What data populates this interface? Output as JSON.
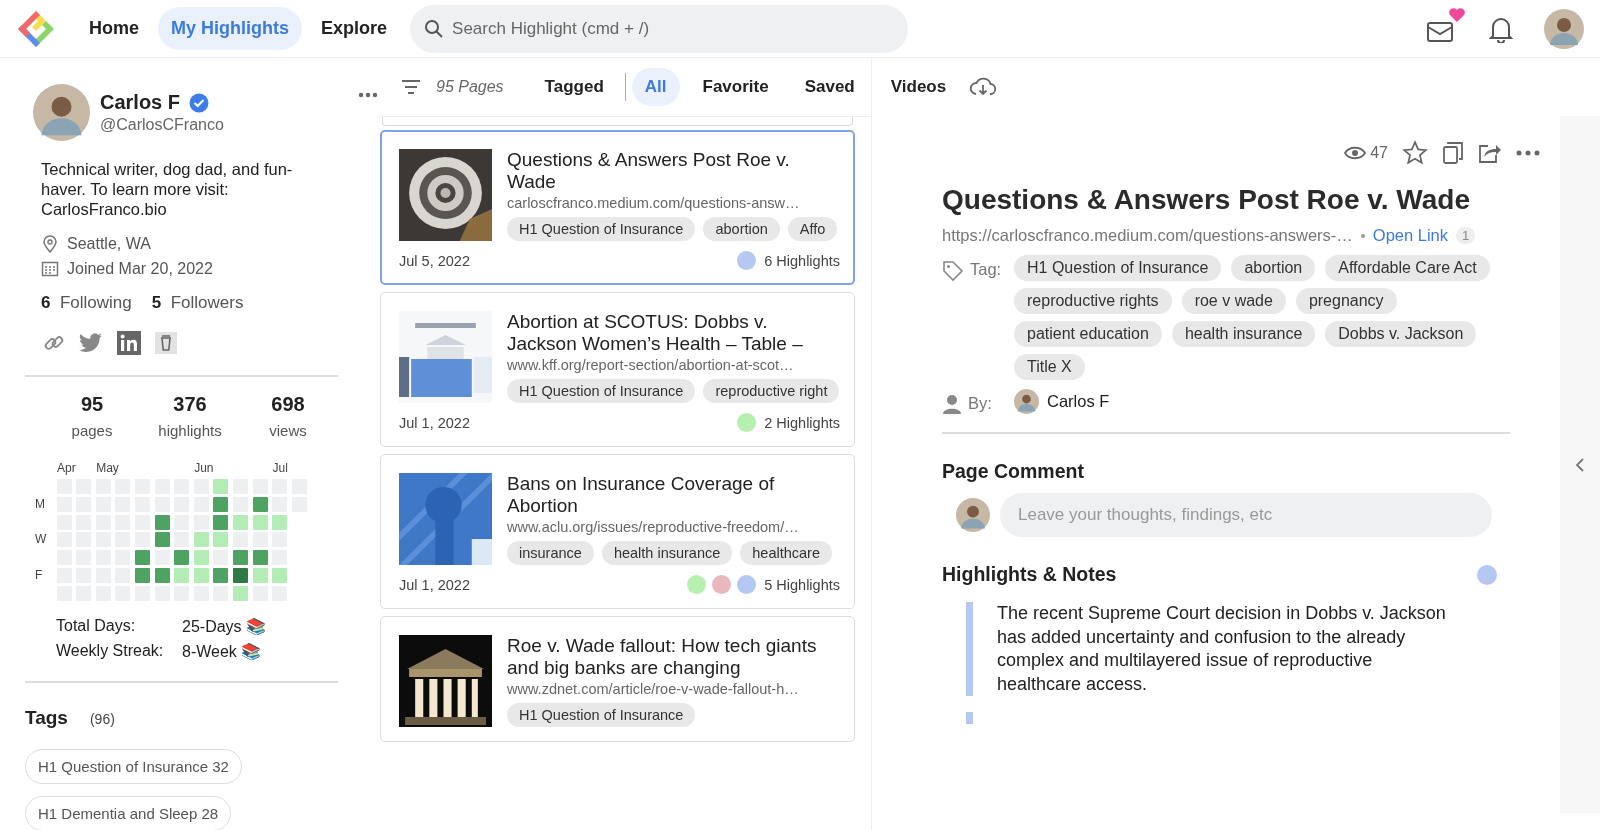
{
  "nav": {
    "items": [
      {
        "label": "Home",
        "selected": false
      },
      {
        "label": "My Highlights",
        "selected": true
      },
      {
        "label": "Explore",
        "selected": false
      }
    ],
    "search": {
      "placeholder": "Search Highlight (cmd + /)"
    },
    "mail_has_new": true
  },
  "profile": {
    "name": "Carlos F",
    "verified": true,
    "handle": "@CarlosCFranco",
    "bio": "Technical writer, dog dad, and fun-haver. To learn more visit: CarlosFranco.bio",
    "location": "Seattle, WA",
    "joined": "Joined Mar 20, 2022",
    "following_count": "6",
    "following_label": "Following",
    "followers_count": "5",
    "followers_label": "Followers"
  },
  "stats": [
    {
      "value": "95",
      "label": "pages"
    },
    {
      "value": "376",
      "label": "highlights"
    },
    {
      "value": "698",
      "label": "views"
    }
  ],
  "activity": {
    "months": [
      "Apr",
      "May",
      "Jun",
      "Jul"
    ],
    "rows": [
      {
        "cells": [
          {
            "color": "#eeeff1"
          },
          {
            "color": "#eeeff1"
          },
          {
            "color": "#eeeff1"
          },
          {
            "color": "#eeeff1"
          },
          {
            "color": "#eeeff1"
          },
          {
            "color": "#eeeff1"
          },
          {
            "color": "#eeeff1"
          },
          {
            "color": "#eeeff1"
          },
          {
            "color": "#b4ecb6"
          },
          {
            "color": "#eeeff1"
          },
          {
            "color": "#eeeff1"
          },
          {
            "color": "#eeeff1"
          },
          {
            "color": "#eeeff1"
          }
        ]
      },
      {
        "day": "M",
        "cells": [
          {
            "color": "#eeeff1"
          },
          {
            "color": "#eeeff1"
          },
          {
            "color": "#eeeff1"
          },
          {
            "color": "#eeeff1"
          },
          {
            "color": "#eeeff1"
          },
          {
            "color": "#eeeff1"
          },
          {
            "color": "#eeeff1"
          },
          {
            "color": "#eeeff1"
          },
          {
            "color": "#4fa362"
          },
          {
            "color": "#eeeff1"
          },
          {
            "color": "#4fa362"
          },
          {
            "color": "#eeeff1"
          },
          {
            "color": "#eeeff1"
          }
        ]
      },
      {
        "cells": [
          {
            "color": "#eeeff1"
          },
          {
            "color": "#eeeff1"
          },
          {
            "color": "#eeeff1"
          },
          {
            "color": "#eeeff1"
          },
          {
            "color": "#eeeff1"
          },
          {
            "color": "#4fa362"
          },
          {
            "color": "#eeeff1"
          },
          {
            "color": "#eeeff1"
          },
          {
            "color": "#4fa362"
          },
          {
            "color": "#b4ecb6"
          },
          {
            "color": "#b4ecb6"
          },
          {
            "color": "#b4ecb6"
          }
        ]
      },
      {
        "day": "W",
        "cells": [
          {
            "color": "#eeeff1"
          },
          {
            "color": "#eeeff1"
          },
          {
            "color": "#eeeff1"
          },
          {
            "color": "#eeeff1"
          },
          {
            "color": "#eeeff1"
          },
          {
            "color": "#4fa362"
          },
          {
            "color": "#eeeff1"
          },
          {
            "color": "#b4ecb6"
          },
          {
            "color": "#b4ecb6"
          },
          {
            "color": "#eeeff1"
          },
          {
            "color": "#eeeff1"
          },
          {
            "color": "#eeeff1"
          }
        ]
      },
      {
        "cells": [
          {
            "color": "#eeeff1"
          },
          {
            "color": "#eeeff1"
          },
          {
            "color": "#eeeff1"
          },
          {
            "color": "#eeeff1"
          },
          {
            "color": "#4fa362"
          },
          {
            "color": "#eeeff1"
          },
          {
            "color": "#4fa362"
          },
          {
            "color": "#b4ecb6"
          },
          {
            "color": "#eeeff1"
          },
          {
            "color": "#4fa362"
          },
          {
            "color": "#4fa362"
          },
          {
            "color": "#eeeff1"
          }
        ]
      },
      {
        "day": "F",
        "cells": [
          {
            "color": "#eeeff1"
          },
          {
            "color": "#eeeff1"
          },
          {
            "color": "#eeeff1"
          },
          {
            "color": "#eeeff1"
          },
          {
            "color": "#4fa362"
          },
          {
            "color": "#4fa362"
          },
          {
            "color": "#b4ecb6"
          },
          {
            "color": "#b4ecb6"
          },
          {
            "color": "#4fa362"
          },
          {
            "color": "#2f7a45"
          },
          {
            "color": "#b4ecb6"
          },
          {
            "color": "#b4ecb6"
          }
        ]
      },
      {
        "cells": [
          {
            "color": "#eeeff1"
          },
          {
            "color": "#eeeff1"
          },
          {
            "color": "#eeeff1"
          },
          {
            "color": "#eeeff1"
          },
          {
            "color": "#eeeff1"
          },
          {
            "color": "#eeeff1"
          },
          {
            "color": "#eeeff1"
          },
          {
            "color": "#eeeff1"
          },
          {
            "color": "#eeeff1"
          },
          {
            "color": "#b4ecb6"
          },
          {
            "color": "#eeeff1"
          },
          {
            "color": "#eeeff1"
          }
        ]
      }
    ],
    "total_label": "Total Days:",
    "total_value": "25-Days 📚",
    "streak_label": "Weekly Streak:",
    "streak_value": "8-Week 📚"
  },
  "tags": {
    "title": "Tags",
    "count": "(96)",
    "items": [
      {
        "label": "H1 Question of Insurance",
        "count": "32"
      },
      {
        "label": "H1 Dementia and Sleep",
        "count": "28"
      }
    ]
  },
  "filter_bar": {
    "page_count": "95 Pages",
    "tabs": [
      {
        "label": "Tagged",
        "selected": false
      },
      {
        "label": "All",
        "selected": true
      },
      {
        "label": "Favorite",
        "selected": false
      },
      {
        "label": "Saved",
        "selected": false
      },
      {
        "label": "Videos",
        "selected": false
      }
    ]
  },
  "pages": [
    {
      "kind": "picture",
      "selected": true,
      "title": "Questions & Answers Post Roe v. Wade",
      "url": "carloscfranco.medium.com/questions-answ…",
      "tags": [
        "H1 Question of Insurance",
        "abortion",
        "Affo"
      ],
      "date": "Jul 5, 2022",
      "dots": [
        {
          "color": "#b4c8f2"
        }
      ],
      "highlights": "6 Highlights"
    },
    {
      "kind": "picture",
      "selected": false,
      "title": "Abortion at SCOTUS: Dobbs v. Jackson Women’s Health – Table –",
      "url": "www.kff.org/report-section/abortion-at-scot…",
      "tags": [
        "H1 Question of Insurance",
        "reproductive right"
      ],
      "date": "Jul 1, 2022",
      "dots": [
        {
          "color": "#b6f0b0"
        }
      ],
      "highlights": "2 Highlights"
    },
    {
      "kind": "picture",
      "selected": false,
      "title": "Bans on Insurance Coverage of Abortion",
      "url": "www.aclu.org/issues/reproductive-freedom/…",
      "tags": [
        "insurance",
        "health insurance",
        "healthcare"
      ],
      "date": "Jul 1, 2022",
      "dots": [
        {
          "color": "#b6f0b0"
        },
        {
          "color": "#e8b8bc"
        },
        {
          "color": "#b4c8f2"
        }
      ],
      "highlights": "5 Highlights"
    },
    {
      "kind": "picture",
      "selected": false,
      "title": "Roe v. Wade fallout: How tech giants and big banks are changing",
      "url": "www.zdnet.com/article/roe-v-wade-fallout-h…",
      "tags": [
        "H1 Question of Insurance"
      ]
    }
  ],
  "detail": {
    "views": "47",
    "title": "Questions & Answers Post Roe v. Wade",
    "url": "https://carloscfranco.medium.com/questions-answers-…",
    "open_link": "Open Link",
    "link_count": "1",
    "tag_label": "Tag:",
    "tags": [
      "H1 Question of Insurance",
      "abortion",
      "Affordable Care Act",
      "reproductive rights",
      "roe v wade",
      "pregnancy",
      "patient education",
      "health insurance",
      "Dobbs v. Jackson",
      "Title X"
    ],
    "by_label": "By:",
    "author": "Carlos F",
    "comment_title": "Page Comment",
    "comment_placeholder": "Leave your thoughts, findings, etc",
    "highlights_title": "Highlights & Notes",
    "color_filters": [
      {
        "color": "#b4c8f2"
      }
    ],
    "notes": [
      {
        "text": "The recent Supreme Court decision in Dobbs v. Jackson has added uncertainty and confusion to the already complex and multilayered issue of reproductive healthcare access.",
        "color": "#b4c8f2"
      },
      {
        "color": "#b4c8f2"
      }
    ]
  }
}
